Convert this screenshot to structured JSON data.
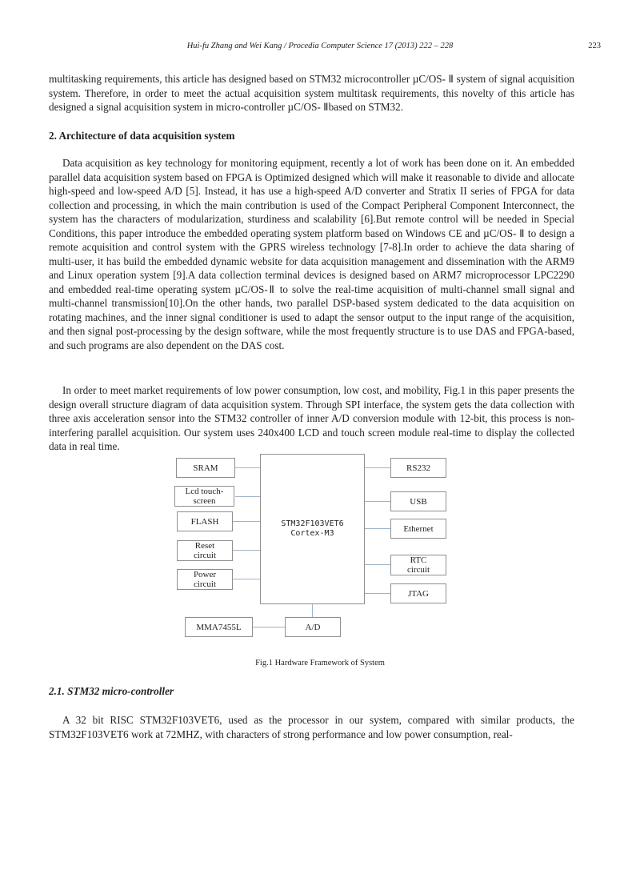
{
  "header": {
    "running_title": "Hui-fu Zhang and Wei Kang / Procedia Computer Science 17 (2013) 222 – 228",
    "page_number": "223"
  },
  "intro_paragraph": "multitasking requirements, this article has designed based on STM32 microcontroller µC/OS- Ⅱ system of signal acquisition system. Therefore, in order to meet the actual acquisition system multitask requirements, this novelty of this article has designed a signal acquisition system in micro-controller µC/OS- Ⅱbased on STM32.",
  "section2": {
    "heading": "2. Architecture of data acquisition system",
    "paragraphs": [
      "Data acquisition as key technology for monitoring equipment, recently a lot of work has been done on it. An embedded parallel data acquisition system based on FPGA is Optimized designed which will make it reasonable to divide and allocate high-speed and low-speed A/D [5]. Instead, it has use a high-speed A/D converter and Stratix II series of FPGA for data collection and processing, in which the main contribution is used of the Compact Peripheral Component Interconnect, the system has the characters of modularization, sturdiness and scalability [6].But  remote control will be needed in Special Conditions, this paper introduce the embedded operating system platform based on Windows CE and  µC/OS- Ⅱ to design a remote acquisition and control system with the GPRS wireless technology [7-8].In order to achieve the data sharing of multi-user, it has build the embedded dynamic website for data acquisition management and dissemination with the ARM9 and Linux operation system [9].A data collection terminal devices is designed based on ARM7 microprocessor LPC2290 and embedded real-time operating system µC/OS-Ⅱ to solve the real-time acquisition of multi-channel small signal and multi-channel transmission[10].On the other hands, two parallel DSP-based system dedicated to the data acquisition on rotating machines, and the inner signal conditioner is used to adapt the sensor output to the input range of the acquisition, and then signal post-processing by the design software, while the most frequently structure is to use DAS and FPGA-based, and such programs are also dependent on the DAS cost.",
      "In order to meet market requirements of low power consumption, low cost, and mobility, Fig.1 in this paper presents the design overall structure diagram of data acquisition system. Through SPI interface, the system gets the data collection with three axis acceleration sensor into the STM32 controller of inner A/D conversion module with 12-bit, this process is non-interfering parallel acquisition. Our system uses 240x400 LCD and touch screen module real-time to display the collected data in real time."
    ]
  },
  "figure1": {
    "cpu_line1": "STM32F103VET6",
    "cpu_line2": "Cortex-M3",
    "left_blocks": [
      "SRAM",
      "Lcd touch-screen",
      "FLASH",
      "Reset circuit",
      "Power circuit"
    ],
    "right_blocks": [
      "RS232",
      "USB",
      "Ethernet",
      "RTC circuit",
      "JTAG"
    ],
    "bottom_blocks": [
      "MMA7455L",
      "A/D"
    ],
    "caption": "Fig.1   Hardware Framework of System"
  },
  "section2_1": {
    "heading": "2.1. STM32 micro-controller",
    "paragraph": "A 32 bit RISC STM32F103VET6, used as the processor in our system, compared with similar products, the STM32F103VET6 work at 72MHZ, with characters of strong performance and low power consumption, real-"
  }
}
